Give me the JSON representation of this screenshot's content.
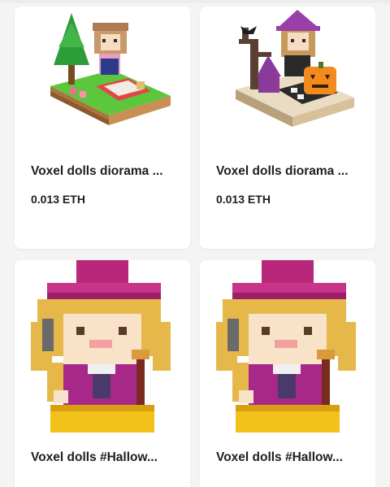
{
  "cards": [
    {
      "title": "Voxel dolls diorama ...",
      "price": "0.013 ETH",
      "image": "voxel-doll-picnic-diorama"
    },
    {
      "title": "Voxel dolls diorama ...",
      "price": "0.013 ETH",
      "image": "voxel-doll-halloween-diorama"
    },
    {
      "title": "Voxel dolls #Hallow...",
      "image": "voxel-doll-witch"
    },
    {
      "title": "Voxel dolls #Hallow...",
      "image": "voxel-doll-witch"
    }
  ]
}
